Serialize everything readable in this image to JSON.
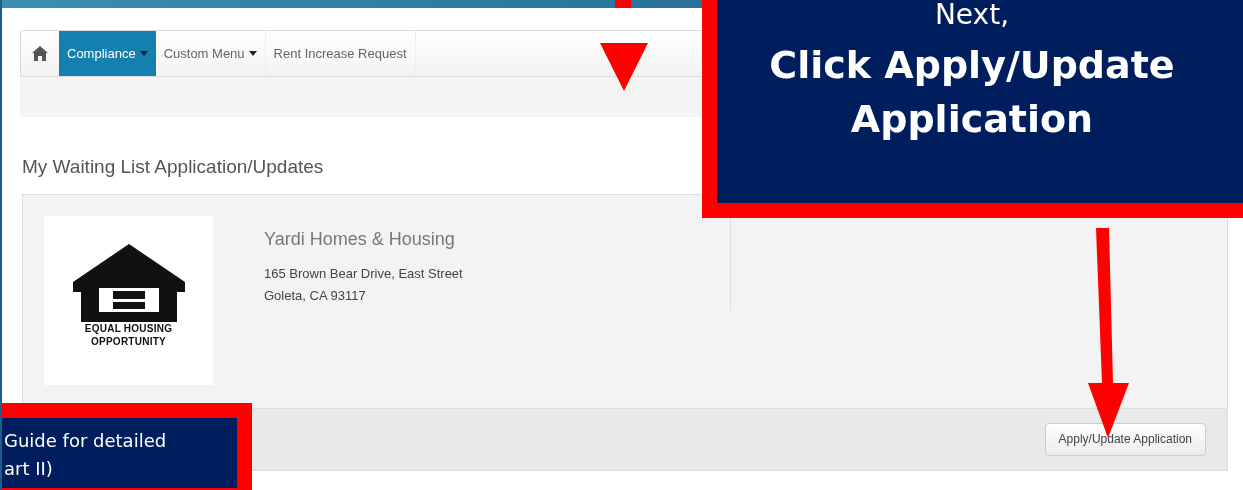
{
  "navbar": {
    "items": [
      {
        "label": "Compliance",
        "selected": true,
        "dropdown": true
      },
      {
        "label": "Custom Menu",
        "selected": false,
        "dropdown": true
      },
      {
        "label": "Rent Increase Request",
        "selected": false,
        "dropdown": false
      }
    ]
  },
  "heading": "My Waiting List Application/Updates",
  "listing": {
    "logo_text": [
      "EQUAL HOUSING",
      "OPPORTUNITY"
    ],
    "name": "Yardi Homes & Housing",
    "address_lines": [
      "165 Brown Bear Drive, East Street",
      "Goleta, CA 93117"
    ],
    "button": "Apply/Update Application"
  },
  "callouts": [
    {
      "kind": "main",
      "intro": "Next,",
      "lines": [
        "Click Apply/Update",
        "Application"
      ]
    },
    {
      "kind": "side",
      "lines": [
        "Guide for detailed",
        "art II)"
      ]
    }
  ]
}
